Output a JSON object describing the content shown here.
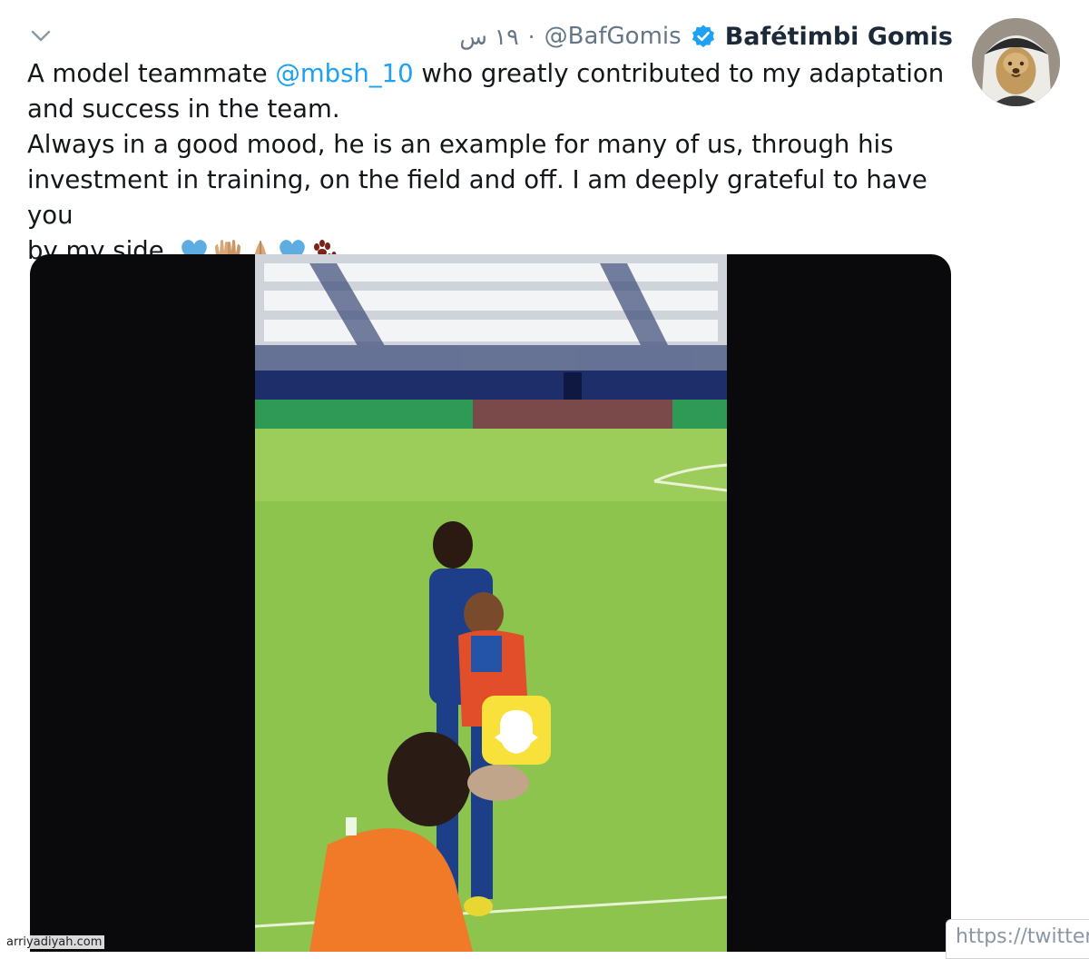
{
  "tweet": {
    "author_name": "Bafétimbi Gomis",
    "author_handle": "@BafGomis",
    "separator": "·",
    "time": "١٩ س",
    "verified": true,
    "text_lines": [
      {
        "before": "A model teammate ",
        "mention": "@mbsh_10",
        "after": " who greatly contributed to my adaptation"
      },
      {
        "text": "and success in the team."
      },
      {
        "text": "Always in a good mood, he is an example for many of us, through his"
      },
      {
        "text": "investment in training, on the field and off. I am deeply grateful to have you"
      },
      {
        "text": "by my side."
      }
    ],
    "emojis": [
      "blue-heart",
      "raising-hands",
      "folded-hands",
      "blue-heart",
      "paw-prints"
    ]
  },
  "media": {
    "type": "video",
    "description_icons": [
      "snapcode-icon"
    ]
  },
  "overlay": {
    "url_text": "https://twitter",
    "watermark": "arriyadiyah.com"
  },
  "colors": {
    "accent": "#1da1f2",
    "verified": "#1da1f2",
    "text": "#14171a",
    "secondary": "#657786"
  }
}
